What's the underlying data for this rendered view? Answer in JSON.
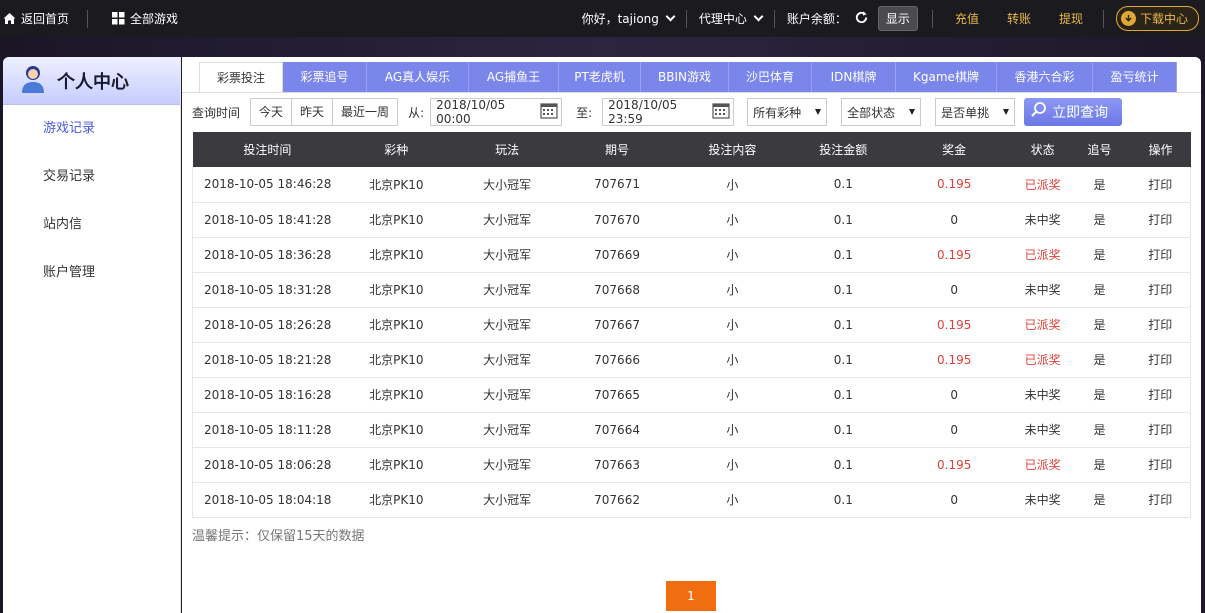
{
  "topbar": {
    "home_label": "返回首页",
    "all_games_label": "全部游戏",
    "greeting": "你好，tajiong",
    "agent_center": "代理中心",
    "balance_label": "账户余额：",
    "show_label": "显示",
    "recharge": "充值",
    "transfer": "转账",
    "withdraw": "提现",
    "download": "下载中心"
  },
  "sidebar": {
    "title": "个人中心",
    "items": [
      {
        "label": "游戏记录",
        "active": true
      },
      {
        "label": "交易记录"
      },
      {
        "label": "站内信"
      },
      {
        "label": "账户管理"
      }
    ]
  },
  "tabs": [
    {
      "label": "彩票投注",
      "active": true
    },
    {
      "label": "彩票追号"
    },
    {
      "label": "AG真人娱乐"
    },
    {
      "label": "AG捕鱼王"
    },
    {
      "label": "PT老虎机"
    },
    {
      "label": "BBIN游戏"
    },
    {
      "label": "沙巴体育"
    },
    {
      "label": "IDN棋牌"
    },
    {
      "label": "Kgame棋牌"
    },
    {
      "label": "香港六合彩"
    },
    {
      "label": "盈亏统计"
    }
  ],
  "filter": {
    "query_time_label": "查询时间",
    "today": "今天",
    "yesterday": "昨天",
    "last_week": "最近一周",
    "from_label": "从:",
    "from_value": "2018/10/05 00:00",
    "to_label": "至:",
    "to_value": "2018/10/05 23:59",
    "lottery_select": "所有彩种",
    "status_select": "全部状态",
    "single_select": "是否单挑",
    "query_button": "立即查询"
  },
  "table": {
    "headers": [
      "投注时间",
      "彩种",
      "玩法",
      "期号",
      "投注内容",
      "投注金额",
      "奖金",
      "状态",
      "追号",
      "操作"
    ],
    "rows": [
      [
        "2018-10-05 18:46:28",
        "北京PK10",
        "大小冠军",
        "707671",
        "小",
        "0.1",
        "0.195",
        "已派奖",
        "是",
        "打印"
      ],
      [
        "2018-10-05 18:41:28",
        "北京PK10",
        "大小冠军",
        "707670",
        "小",
        "0.1",
        "0",
        "未中奖",
        "是",
        "打印"
      ],
      [
        "2018-10-05 18:36:28",
        "北京PK10",
        "大小冠军",
        "707669",
        "小",
        "0.1",
        "0.195",
        "已派奖",
        "是",
        "打印"
      ],
      [
        "2018-10-05 18:31:28",
        "北京PK10",
        "大小冠军",
        "707668",
        "小",
        "0.1",
        "0",
        "未中奖",
        "是",
        "打印"
      ],
      [
        "2018-10-05 18:26:28",
        "北京PK10",
        "大小冠军",
        "707667",
        "小",
        "0.1",
        "0.195",
        "已派奖",
        "是",
        "打印"
      ],
      [
        "2018-10-05 18:21:28",
        "北京PK10",
        "大小冠军",
        "707666",
        "小",
        "0.1",
        "0.195",
        "已派奖",
        "是",
        "打印"
      ],
      [
        "2018-10-05 18:16:28",
        "北京PK10",
        "大小冠军",
        "707665",
        "小",
        "0.1",
        "0",
        "未中奖",
        "是",
        "打印"
      ],
      [
        "2018-10-05 18:11:28",
        "北京PK10",
        "大小冠军",
        "707664",
        "小",
        "0.1",
        "0",
        "未中奖",
        "是",
        "打印"
      ],
      [
        "2018-10-05 18:06:28",
        "北京PK10",
        "大小冠军",
        "707663",
        "小",
        "0.1",
        "0.195",
        "已派奖",
        "是",
        "打印"
      ],
      [
        "2018-10-05 18:04:18",
        "北京PK10",
        "大小冠军",
        "707662",
        "小",
        "0.1",
        "0",
        "未中奖",
        "是",
        "打印"
      ]
    ]
  },
  "tip": "温馨提示：仅保留15天的数据",
  "pagination": {
    "current": "1"
  },
  "colors": {
    "tab": "#7b86ea",
    "win": "#e0413a",
    "pager": "#f06e10",
    "gold": "#e8b948"
  }
}
